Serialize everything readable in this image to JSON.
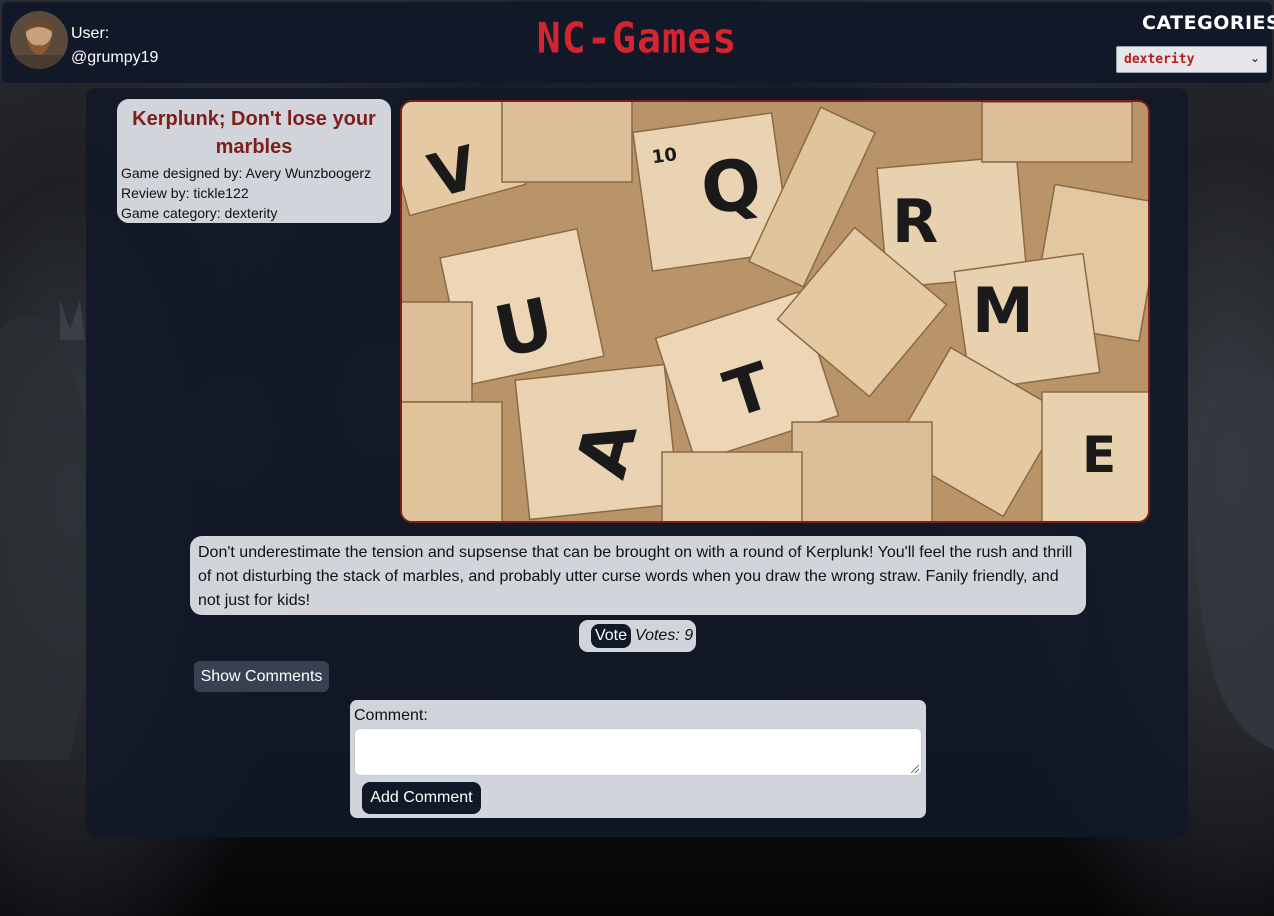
{
  "header": {
    "user_label": "User:",
    "username": "@grumpy19",
    "brand": "NC-Games",
    "categories_title": "CATEGORIES",
    "category_selected": "dexterity"
  },
  "review": {
    "title": "Kerplunk; Don't lose your marbles",
    "designer": "Game designed by: Avery Wunzboogerz",
    "reviewer": "Review by: tickle122",
    "category": "Game category: dexterity",
    "body": "Don't underestimate the tension and supsense that can be brought on with a round of Kerplunk! You'll feel the rush and thrill of not disturbing the stack of marbles, and probably utter curse words when you draw the wrong straw. Fanily friendly, and not just for kids!",
    "vote_label": "Vote",
    "votes_text": "Votes: 9"
  },
  "comments": {
    "show_label": "Show Comments",
    "form_label": "Comment:",
    "textarea_value": "",
    "add_label": "Add Comment"
  },
  "colors": {
    "brand_red": "#d3242f",
    "title_maroon": "#7f1d1d",
    "navy": "#111827",
    "card_gray": "#d1d5db"
  },
  "icons": {
    "select_arrow": "chevron-down-icon",
    "textarea_resize": "resize-grip-icon"
  }
}
